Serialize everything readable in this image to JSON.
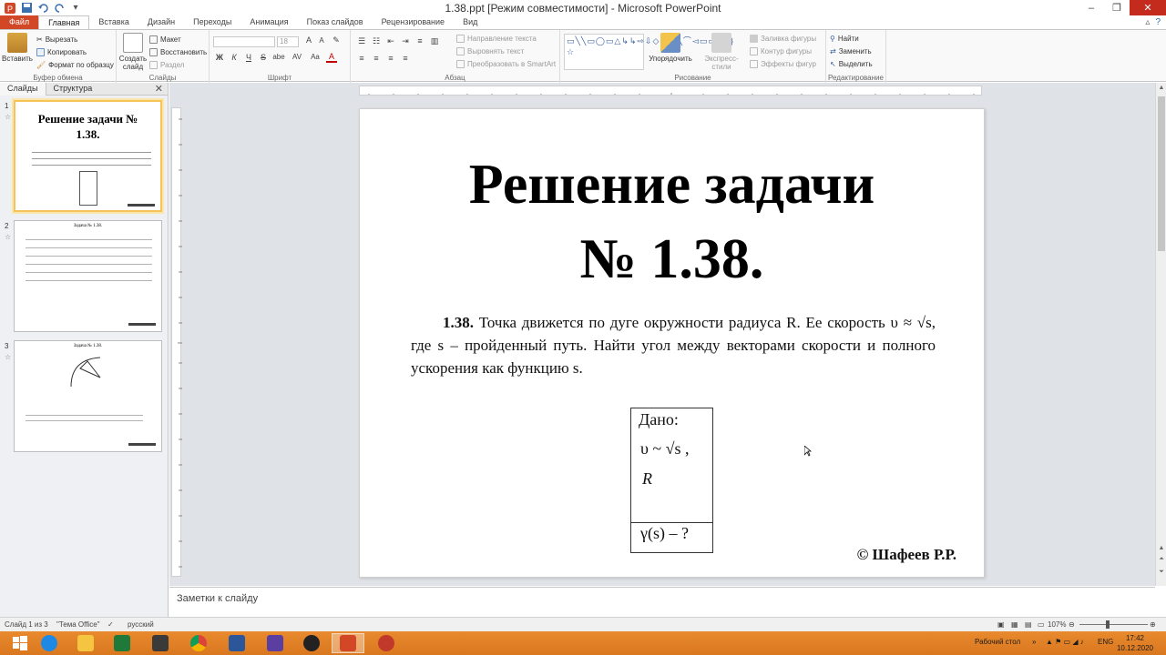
{
  "window": {
    "title": "1.38.ppt [Режим совместимости] - Microsoft PowerPoint"
  },
  "tabs": [
    "Файл",
    "Главная",
    "Вставка",
    "Дизайн",
    "Переходы",
    "Анимация",
    "Показ слайдов",
    "Рецензирование",
    "Вид"
  ],
  "ribbon": {
    "clipboard": {
      "label": "Буфер обмена",
      "paste": "Вставить",
      "cut": "Вырезать",
      "copy": "Копировать",
      "format_painter": "Формат по образцу"
    },
    "slides": {
      "label": "Слайды",
      "new_slide": "Создать слайд",
      "layout": "Макет",
      "reset": "Восстановить",
      "section": "Раздел"
    },
    "font": {
      "label": "Шрифт",
      "size": "18",
      "bold": "Ж",
      "italic": "К",
      "underline": "Ч",
      "strike": "S",
      "shadow": "abe",
      "spacing": "AV",
      "case": "Aa",
      "color": "A"
    },
    "paragraph": {
      "label": "Абзац",
      "text_direction": "Направление текста",
      "align_text": "Выровнять текст",
      "smartart": "Преобразовать в SmartArt"
    },
    "drawing": {
      "label": "Рисование",
      "arrange": "Упорядочить",
      "quick_styles": "Экспресс-стили",
      "shape_fill": "Заливка фигуры",
      "shape_outline": "Контур фигуры",
      "shape_effects": "Эффекты фигур"
    },
    "editing": {
      "label": "Редактирование",
      "find": "Найти",
      "replace": "Заменить",
      "select": "Выделить"
    }
  },
  "leftpane": {
    "tab_slides": "Слайды",
    "tab_outline": "Структура",
    "thumbs": [
      {
        "num": "1",
        "title": "Решение задачи № 1.38."
      },
      {
        "num": "2",
        "title": "Задача № 1.38."
      },
      {
        "num": "3",
        "title": "Задача № 1.38."
      }
    ]
  },
  "slide": {
    "title_line1": "Решение задачи",
    "title_line2": "№ 1.38.",
    "problem_num": "1.38.",
    "problem_text": "Точка движется по дуге окружности радиуса R. Ее скорость υ ≈ √s, где s – пройденный путь. Найти угол между векторами скорости и полного ускорения как функцию s.",
    "given_label": "Дано:",
    "given_v": "υ ~ √s ,",
    "given_r": "R",
    "find": "γ(s) – ?",
    "copyright": "© Шафеев Р.Р."
  },
  "notes": {
    "placeholder": "Заметки к слайду"
  },
  "status": {
    "slide_info": "Слайд 1 из 3",
    "theme": "\"Тема Office\"",
    "language": "русский",
    "zoom": "107%"
  },
  "taskbar": {
    "desktop": "Рабочий стол",
    "lang": "ENG",
    "time": "17:42",
    "date": "10.12.2020"
  }
}
